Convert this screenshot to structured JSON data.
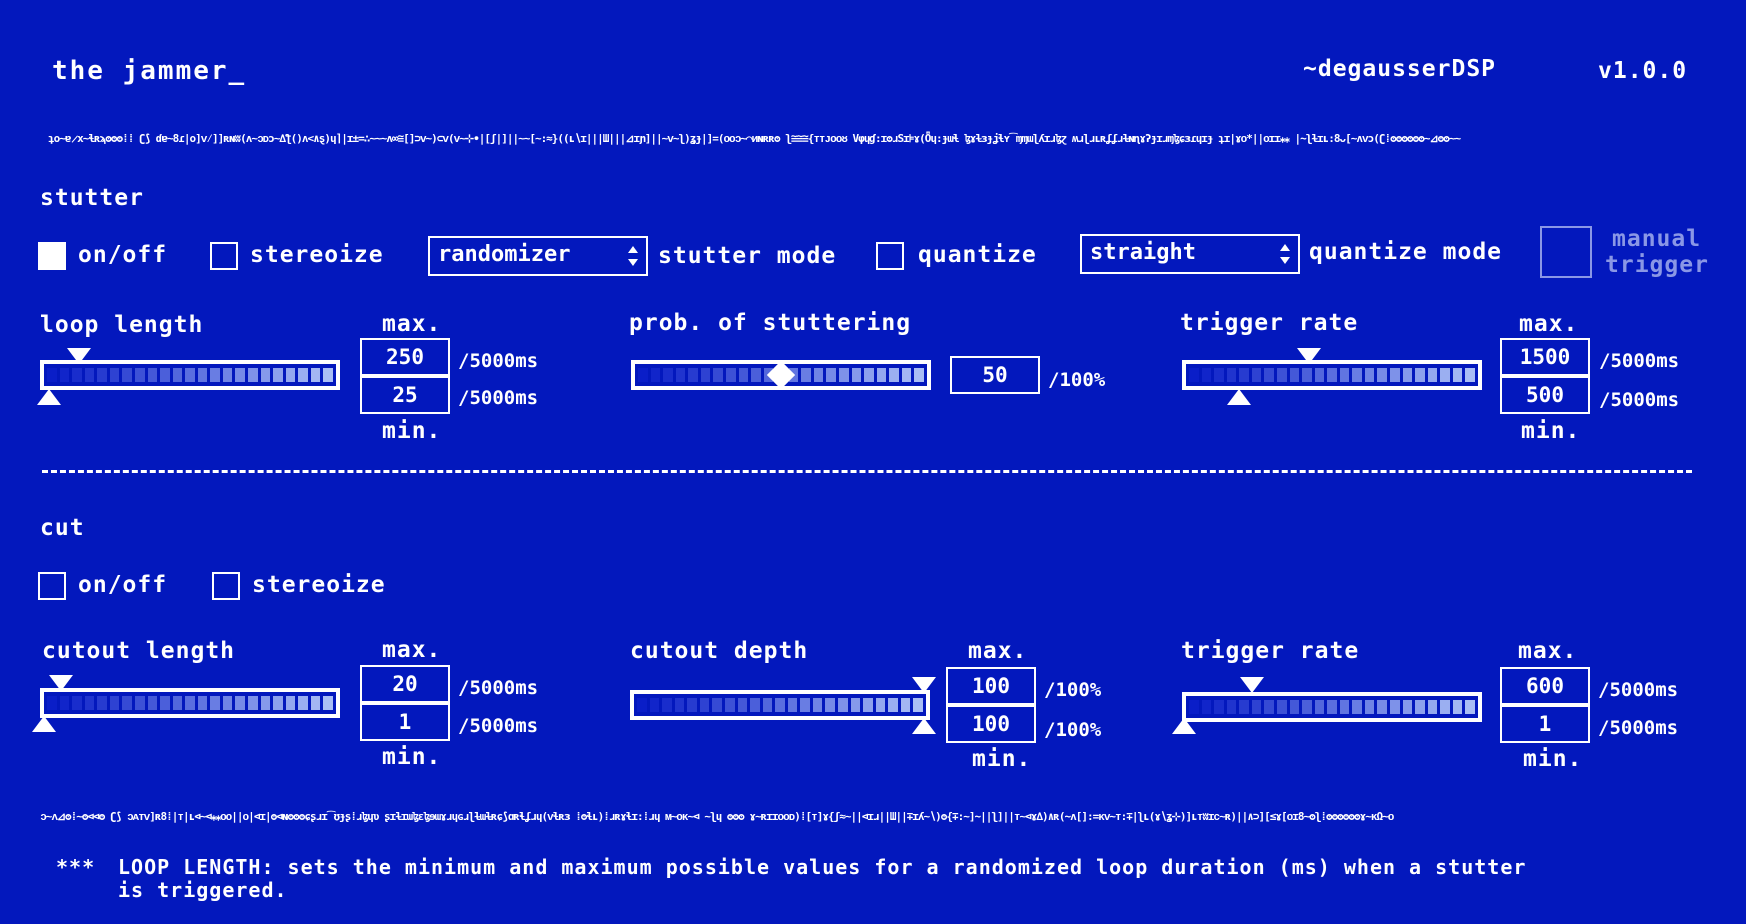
{
  "header": {
    "title": "the jammer_",
    "brand": "~degausserDSP",
    "version": "v1.0.0",
    "noise_top": "ʇo~ɐ̷x~ɬʀϡʘʘʘ⁞⁞ ʗ⟆ ɗɐ~8ɾ|o]ᴠ⁄]]ʀɴʬ(ʌ~ᴐᴅɔ~∆ƪ()ʌ<∧ȿ)ɥ⌉|ɪ±=∴~~~ʌ∞≅[]⊃ᴠ~)⊂ᴠ(ᴠ~⊹∙|[ʃ|]||~~[~:≈}((ʟ∖ɪ|||Ш|||⊿ɪɲ]||~ᴠ~ʅ)ʓɟ|]=(ᴏᴏᴐ~⌒ᴎɴʀʀʘ ʅ≅≅≅{ᴛᴛᴊᴏᴏᴕ Vφɥɠ:ɪʘɹSɪ⊧ɤ(Ȫɥ:ɟɯɬ ɮɤɫɜɟʝɬʏ͡ɱɱɯɭʎɪɹɮɀ ʍɹɭɹʟʀʆʆɹɫɴɳɤʔɟɪɹɱɮɕɜɾɥɪɟ ʇɪ|ɤᴏ*||ᴏɪɪ⁎⁎ |∼ʅɫɪʟ:8ᴗ[~ʌᴠɔ(ʗ⁞ʘʘʘʘʘʘ~⊿ʘʘ~~"
  },
  "stutter": {
    "heading": "stutter",
    "onoff_label": "on/off",
    "onoff_checked": true,
    "stereoize_label": "stereoize",
    "stereoize_checked": false,
    "mode_value": "randomizer",
    "mode_label": "stutter mode",
    "quantize_label": "quantize",
    "quantize_checked": false,
    "quantize_mode_value": "straight",
    "quantize_mode_label": "quantize mode",
    "manual_trigger_label_1": "manual",
    "manual_trigger_label_2": "trigger",
    "loop_length": {
      "label": "loop length",
      "max_label": "max.",
      "min_label": "min.",
      "max_value": "250",
      "min_value": "25",
      "max_unit": "/5000ms",
      "min_unit": "/5000ms"
    },
    "prob": {
      "label": "prob. of stuttering",
      "value": "50",
      "unit": "/100%"
    },
    "trigger_rate": {
      "label": "trigger rate",
      "max_label": "max.",
      "min_label": "min.",
      "max_value": "1500",
      "min_value": "500",
      "max_unit": "/5000ms",
      "min_unit": "/5000ms"
    }
  },
  "cut": {
    "heading": "cut",
    "onoff_label": "on/off",
    "onoff_checked": false,
    "stereoize_label": "stereoize",
    "stereoize_checked": false,
    "cutout_length": {
      "label": "cutout length",
      "max_label": "max.",
      "min_label": "min.",
      "max_value": "20",
      "min_value": "1",
      "max_unit": "/5000ms",
      "min_unit": "/5000ms"
    },
    "cutout_depth": {
      "label": "cutout depth",
      "max_label": "max.",
      "min_label": "min.",
      "max_value": "100",
      "min_value": "100",
      "max_unit": "/100%",
      "min_unit": "/100%"
    },
    "trigger_rate": {
      "label": "trigger rate",
      "max_label": "max.",
      "min_label": "min.",
      "max_value": "600",
      "min_value": "1",
      "max_unit": "/5000ms",
      "min_unit": "/5000ms"
    }
  },
  "footer": {
    "noise_bottom": "ᴐ~ᴧ⊿ʘ⁞~ʘ⊲⊲ʘ ʗ⟆ ᴐᴀᴛᴠ]ʀ8⁞|ᴛ|ʟ⊲~⊲⁎⁎ᴏᴏ||ᴏ|⊲ɪ|ʘ⊲ɴʘʘʘɕʂɹɪ͡ʊɟʂ⁞ɹɮɥʋ ʂɪɫɪɯɮɛɮɘɯɤɹɥɢɹɭɫɯɫʀɕ⟆ɑʀɬʆɹɥ(ᴠɬʀɜ ⁞ʘɬʟ)⁞ɹʀɤɬɪ:⁞ɹɥ ᴍ~ᴏᴋ~⊲ ~ʅɥ ʘʘʘ ɤ~ʀɪɪᴏᴏᴅ)⁞[ᴛ]ɤ{ʃ≈~||⊲ɪɹ||Ш||∓ɪʎ~∖)ʘ{∓:~]∼||ʅ]||ᴛ~⊲ɤ∆)∧ʀ(∼ʌ[]:=ᴋᴠ~ᴛ:∓|ʅʟ(ɤ∖ʓ⊹)]ʟᴛʬɪᴄ~ʀ)||∧⊃][≤ɤ[ᴏɪ8~ʘʅ⁞ʘʘʘʘʘʘɤ~ᴋΩ~ᴏ",
    "help_marker": "***",
    "help_text": "LOOP LENGTH: sets the minimum and maximum possible values for a randomized loop duration (ms) when a stutter\nis triggered."
  },
  "colors": {
    "background": "#0318bd",
    "foreground": "#ffffff",
    "disabled": "#8a97e6"
  }
}
